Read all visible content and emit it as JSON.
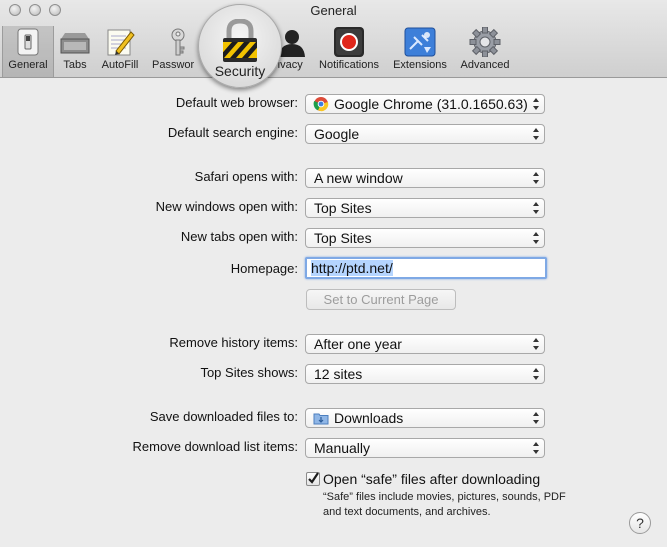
{
  "window": {
    "title": "General"
  },
  "toolbar": {
    "items": [
      {
        "label": "General",
        "icon": "general-switch-icon",
        "selected": true
      },
      {
        "label": "Tabs",
        "icon": "tabs-icon"
      },
      {
        "label": "AutoFill",
        "icon": "autofill-pencil-icon"
      },
      {
        "label": "Passwords",
        "icon": "key-icon"
      },
      {
        "label": "Security",
        "icon": "padlock-icon"
      },
      {
        "label": "Privacy",
        "icon": "person-silhouette-icon"
      },
      {
        "label": "Notifications",
        "icon": "notifications-icon"
      },
      {
        "label": "Extensions",
        "icon": "extensions-puzzle-icon"
      },
      {
        "label": "Advanced",
        "icon": "gear-icon"
      }
    ],
    "passwords_visible": "Passwor",
    "privacy_visible": "rivacy",
    "magnified_label": "Security"
  },
  "form": {
    "default_browser": {
      "label": "Default web browser:",
      "value": "Google Chrome (31.0.1650.63)"
    },
    "search_engine": {
      "label": "Default search engine:",
      "value": "Google"
    },
    "safari_opens": {
      "label": "Safari opens with:",
      "value": "A new window"
    },
    "new_windows": {
      "label": "New windows open with:",
      "value": "Top Sites"
    },
    "new_tabs": {
      "label": "New tabs open with:",
      "value": "Top Sites"
    },
    "homepage": {
      "label": "Homepage:",
      "value": "http://ptd.net/"
    },
    "set_current_page": "Set to Current Page",
    "remove_history": {
      "label": "Remove history items:",
      "value": "After one year"
    },
    "top_sites": {
      "label": "Top Sites shows:",
      "value": "12 sites"
    },
    "save_downloads": {
      "label": "Save downloaded files to:",
      "value": "Downloads"
    },
    "remove_downloads": {
      "label": "Remove download list items:",
      "value": "Manually"
    },
    "open_safe": {
      "label": "Open “safe” files after downloading",
      "checked": true
    },
    "safe_note": "“Safe” files include movies, pictures, sounds, PDF and text documents, and archives."
  },
  "help": "?",
  "colors": {
    "focus_ring": "#7fa9e5",
    "selection": "#b5d5ff",
    "notification_red": "#e0271b"
  }
}
